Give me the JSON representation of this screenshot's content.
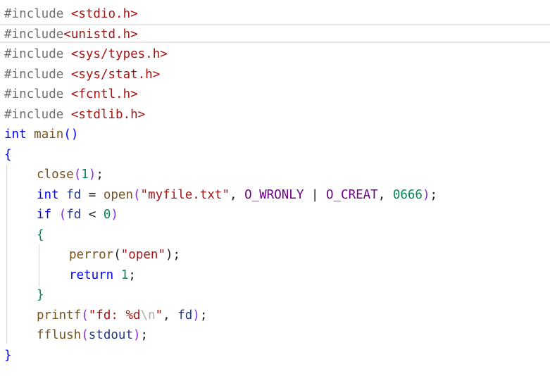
{
  "code": {
    "lines": [
      {
        "indent": 0,
        "tokens": [
          {
            "t": "#include ",
            "c": "pp"
          },
          {
            "t": "<stdio.h>",
            "c": "hdr"
          }
        ]
      },
      {
        "indent": 0,
        "tokens": [
          {
            "t": "#include",
            "c": "pp"
          },
          {
            "t": "<unistd.h>",
            "c": "hdr"
          }
        ]
      },
      {
        "indent": 0,
        "tokens": [
          {
            "t": "#include ",
            "c": "pp"
          },
          {
            "t": "<sys/types.h>",
            "c": "hdr"
          }
        ]
      },
      {
        "indent": 0,
        "tokens": [
          {
            "t": "#include ",
            "c": "pp"
          },
          {
            "t": "<sys/stat.h>",
            "c": "hdr"
          }
        ]
      },
      {
        "indent": 0,
        "tokens": [
          {
            "t": "#include ",
            "c": "pp"
          },
          {
            "t": "<fcntl.h>",
            "c": "hdr"
          }
        ]
      },
      {
        "indent": 0,
        "tokens": [
          {
            "t": "#include ",
            "c": "pp"
          },
          {
            "t": "<stdlib.h>",
            "c": "hdr"
          }
        ]
      },
      {
        "indent": 0,
        "tokens": [
          {
            "t": "int",
            "c": "kw"
          },
          {
            "t": " ",
            "c": "op"
          },
          {
            "t": "main",
            "c": "fn"
          },
          {
            "t": "()",
            "c": "paren-blue"
          }
        ]
      },
      {
        "indent": 0,
        "tokens": [
          {
            "t": "{",
            "c": "brace-outer"
          }
        ]
      },
      {
        "indent": 1,
        "tokens": [
          {
            "t": "close",
            "c": "fn"
          },
          {
            "t": "(",
            "c": "paren-purple"
          },
          {
            "t": "1",
            "c": "num"
          },
          {
            "t": ")",
            "c": "paren-purple"
          },
          {
            "t": ";",
            "c": "op"
          }
        ]
      },
      {
        "indent": 1,
        "tokens": [
          {
            "t": "int",
            "c": "kw"
          },
          {
            "t": " ",
            "c": "op"
          },
          {
            "t": "fd",
            "c": "var"
          },
          {
            "t": " = ",
            "c": "op"
          },
          {
            "t": "open",
            "c": "fn"
          },
          {
            "t": "(",
            "c": "paren-purple"
          },
          {
            "t": "\"myfile.txt\"",
            "c": "str"
          },
          {
            "t": ", ",
            "c": "op"
          },
          {
            "t": "O_WRONLY",
            "c": "macro"
          },
          {
            "t": " | ",
            "c": "op"
          },
          {
            "t": "O_CREAT",
            "c": "macro"
          },
          {
            "t": ", ",
            "c": "op"
          },
          {
            "t": "0666",
            "c": "num"
          },
          {
            "t": ")",
            "c": "paren-purple"
          },
          {
            "t": ";",
            "c": "op"
          }
        ]
      },
      {
        "indent": 1,
        "tokens": [
          {
            "t": "if",
            "c": "kw"
          },
          {
            "t": " ",
            "c": "op"
          },
          {
            "t": "(",
            "c": "paren-purple"
          },
          {
            "t": "fd",
            "c": "var"
          },
          {
            "t": " < ",
            "c": "op"
          },
          {
            "t": "0",
            "c": "num"
          },
          {
            "t": ")",
            "c": "paren-purple"
          }
        ]
      },
      {
        "indent": 1,
        "tokens": [
          {
            "t": "{",
            "c": "brace-inner"
          }
        ]
      },
      {
        "indent": 2,
        "tokens": [
          {
            "t": "perror",
            "c": "fn"
          },
          {
            "t": "(",
            "c": "paren"
          },
          {
            "t": "\"open\"",
            "c": "str"
          },
          {
            "t": ")",
            "c": "paren"
          },
          {
            "t": ";",
            "c": "op"
          }
        ]
      },
      {
        "indent": 2,
        "tokens": [
          {
            "t": "return",
            "c": "kw"
          },
          {
            "t": " ",
            "c": "op"
          },
          {
            "t": "1",
            "c": "num"
          },
          {
            "t": ";",
            "c": "op"
          }
        ]
      },
      {
        "indent": 1,
        "tokens": [
          {
            "t": "}",
            "c": "brace-inner"
          }
        ]
      },
      {
        "indent": 1,
        "tokens": [
          {
            "t": "printf",
            "c": "fn"
          },
          {
            "t": "(",
            "c": "paren-purple"
          },
          {
            "t": "\"fd: %d",
            "c": "str"
          },
          {
            "t": "\\n",
            "c": "esc"
          },
          {
            "t": "\"",
            "c": "str"
          },
          {
            "t": ", ",
            "c": "op"
          },
          {
            "t": "fd",
            "c": "var"
          },
          {
            "t": ")",
            "c": "paren-purple"
          },
          {
            "t": ";",
            "c": "op"
          }
        ]
      },
      {
        "indent": 1,
        "tokens": [
          {
            "t": "fflush",
            "c": "fn"
          },
          {
            "t": "(",
            "c": "paren-purple"
          },
          {
            "t": "stdout",
            "c": "var"
          },
          {
            "t": ")",
            "c": "paren-purple"
          },
          {
            "t": ";",
            "c": "op"
          }
        ]
      },
      {
        "indent": 0,
        "tokens": [
          {
            "t": "}",
            "c": "brace-outer"
          }
        ]
      }
    ]
  },
  "colors": {
    "preprocessor": "#6e6e6e",
    "header": "#a31515",
    "keyword": "#0000ff",
    "function": "#74531f",
    "variable": "#1f377f",
    "macro": "#6f008a",
    "number": "#098658",
    "string": "#a31515",
    "escape": "#b0b0b0",
    "current_line_border": "#e8e8e8",
    "indent_guide": "#d3d3d3",
    "background": "#ffffff"
  }
}
